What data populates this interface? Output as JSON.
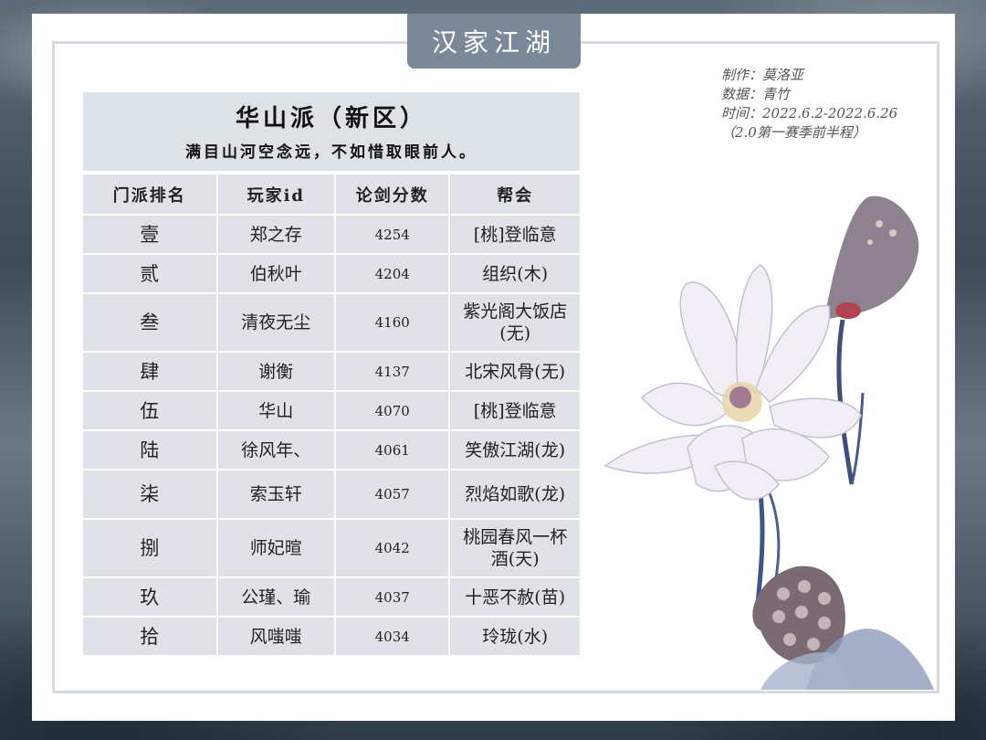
{
  "banner": "汉家江湖",
  "credits": {
    "maker": "制作：莫洛亚",
    "data": "数据：青竹",
    "time": "时间：2022.6.2-2022.6.26",
    "season": "（2.0第一赛季前半程）"
  },
  "table": {
    "title": "华山派（新区）",
    "subtitle": "满目山河空念远，不如惜取眼前人。",
    "headers": [
      "门派排名",
      "玩家id",
      "论剑分数",
      "帮会"
    ],
    "rows": [
      {
        "rank": "壹",
        "player": "郑之存",
        "score": "4254",
        "guild": "[桃]登临意"
      },
      {
        "rank": "贰",
        "player": "伯秋叶",
        "score": "4204",
        "guild": "组织(木)"
      },
      {
        "rank": "叁",
        "player": "清夜无尘",
        "score": "4160",
        "guild": "紫光阁大饭店(无)"
      },
      {
        "rank": "肆",
        "player": "谢衡",
        "score": "4137",
        "guild": "北宋风骨(无)"
      },
      {
        "rank": "伍",
        "player": "华山",
        "score": "4070",
        "guild": "[桃]登临意"
      },
      {
        "rank": "陆",
        "player": "徐风年、",
        "score": "4061",
        "guild": "笑傲江湖(龙)"
      },
      {
        "rank": "柒",
        "player": "索玉轩",
        "score": "4057",
        "guild": "烈焰如歌(龙)"
      },
      {
        "rank": "捌",
        "player": "师妃暄",
        "score": "4042",
        "guild": "桃园春风一杯酒(天)"
      },
      {
        "rank": "玖",
        "player": "公瑾、瑜",
        "score": "4037",
        "guild": "十恶不赦(苗)"
      },
      {
        "rank": "拾",
        "player": "风嗤嗤",
        "score": "4034",
        "guild": "玲珑(水)"
      }
    ]
  },
  "colors": {
    "banner_bg": "#7b8898",
    "cell_bg": "#dfe3e8",
    "frame": "#d6dbe1"
  },
  "decoration": "lotus-flower-illustration"
}
